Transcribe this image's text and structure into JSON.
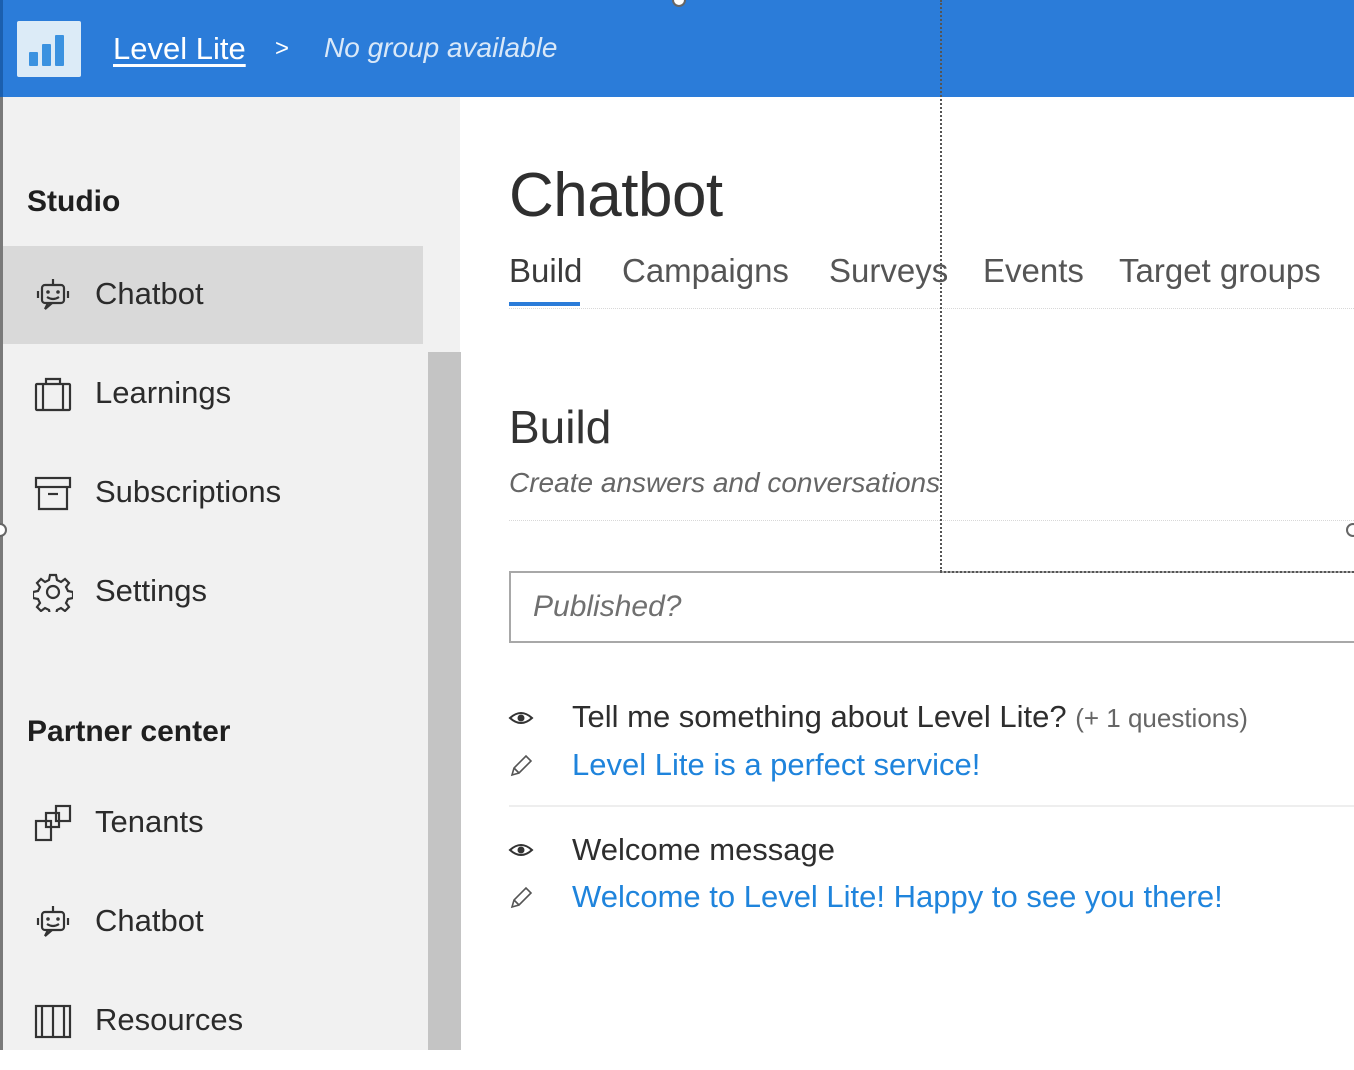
{
  "header": {
    "app_name": "Level Lite",
    "breadcrumb_separator": ">",
    "group_text": "No group available",
    "bg_color": "#2b7cd9"
  },
  "sidebar": {
    "sections": [
      {
        "title": "Studio",
        "items": [
          {
            "label": "Chatbot",
            "icon": "chatbot-icon",
            "active": true
          },
          {
            "label": "Learnings",
            "icon": "briefcase-icon"
          },
          {
            "label": "Subscriptions",
            "icon": "archive-icon"
          },
          {
            "label": "Settings",
            "icon": "gear-icon"
          }
        ]
      },
      {
        "title": "Partner center",
        "items": [
          {
            "label": "Tenants",
            "icon": "tenants-icon"
          },
          {
            "label": "Chatbot",
            "icon": "chatbot-icon"
          },
          {
            "label": "Resources",
            "icon": "book-icon"
          }
        ]
      }
    ]
  },
  "main": {
    "title": "Chatbot",
    "tabs": [
      {
        "label": "Build",
        "active": true
      },
      {
        "label": "Campaigns"
      },
      {
        "label": "Surveys"
      },
      {
        "label": "Events"
      },
      {
        "label": "Target groups"
      }
    ],
    "section": {
      "title": "Build",
      "subtitle": "Create answers and conversations"
    },
    "filter": {
      "placeholder": "Published?"
    },
    "qna": [
      {
        "question": "Tell me something about Level Lite?",
        "extra": "(+ 1 questions)",
        "answer": "Level Lite is a perfect service!"
      },
      {
        "question": "Welcome message",
        "extra": "",
        "answer": "Welcome to Level Lite! Happy to see you there!"
      }
    ]
  },
  "colors": {
    "accent": "#2b7cd9",
    "link": "#1f84dc",
    "sidebar_bg": "#f1f1f1",
    "sidebar_active": "#d9d9d9"
  }
}
